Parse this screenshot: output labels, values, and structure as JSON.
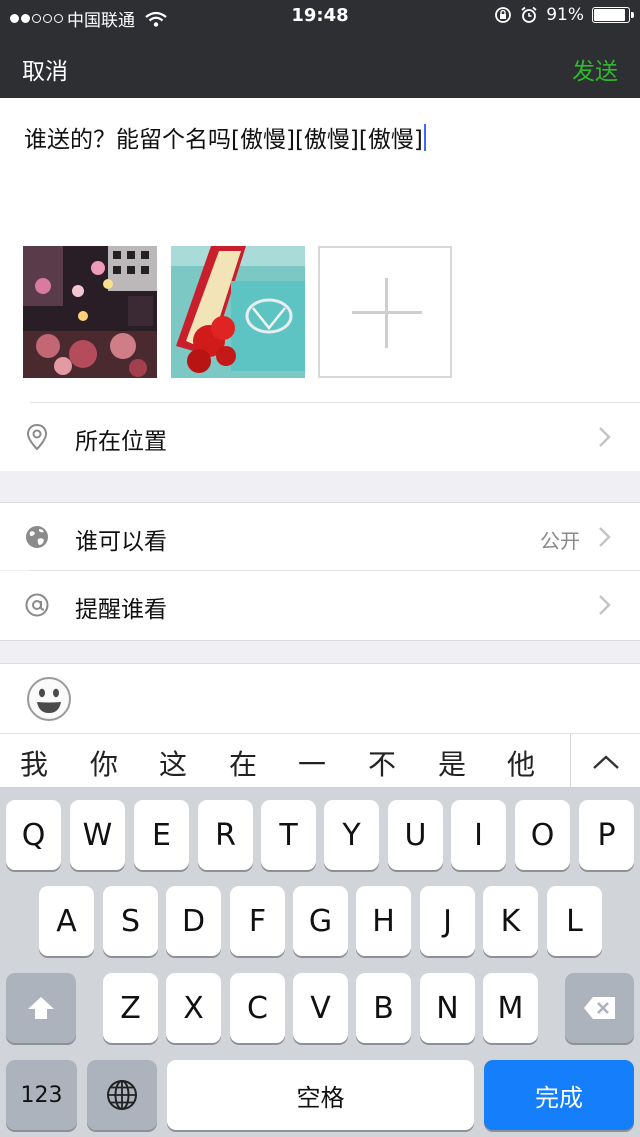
{
  "status_bar": {
    "carrier": "中国联通",
    "time": "19:48",
    "battery": "91%",
    "signal_dots": [
      true,
      true,
      false,
      false,
      false
    ]
  },
  "nav": {
    "cancel": "取消",
    "send": "发送"
  },
  "compose": {
    "text": "谁送的？能留个名吗[傲慢][傲慢][傲慢]",
    "photos": [
      "party-photo",
      "gift-box-photo"
    ]
  },
  "rows": {
    "location": {
      "label": "所在位置",
      "icon": "location-pin-icon"
    },
    "visibility": {
      "label": "谁可以看",
      "value": "公开",
      "icon": "globe-icon"
    },
    "mention": {
      "label": "提醒谁看",
      "icon": "at-icon"
    }
  },
  "candidates": [
    "我",
    "你",
    "这",
    "在",
    "一",
    "不",
    "是",
    "他"
  ],
  "keyboard": {
    "row1": [
      "Q",
      "W",
      "E",
      "R",
      "T",
      "Y",
      "U",
      "I",
      "O",
      "P"
    ],
    "row2": [
      "A",
      "S",
      "D",
      "F",
      "G",
      "H",
      "J",
      "K",
      "L"
    ],
    "row3": [
      "Z",
      "X",
      "C",
      "V",
      "B",
      "N",
      "M"
    ],
    "numbers": "123",
    "space": "空格",
    "done": "完成"
  },
  "colors": {
    "accent_green": "#2eb82e",
    "done_blue": "#147efb"
  }
}
